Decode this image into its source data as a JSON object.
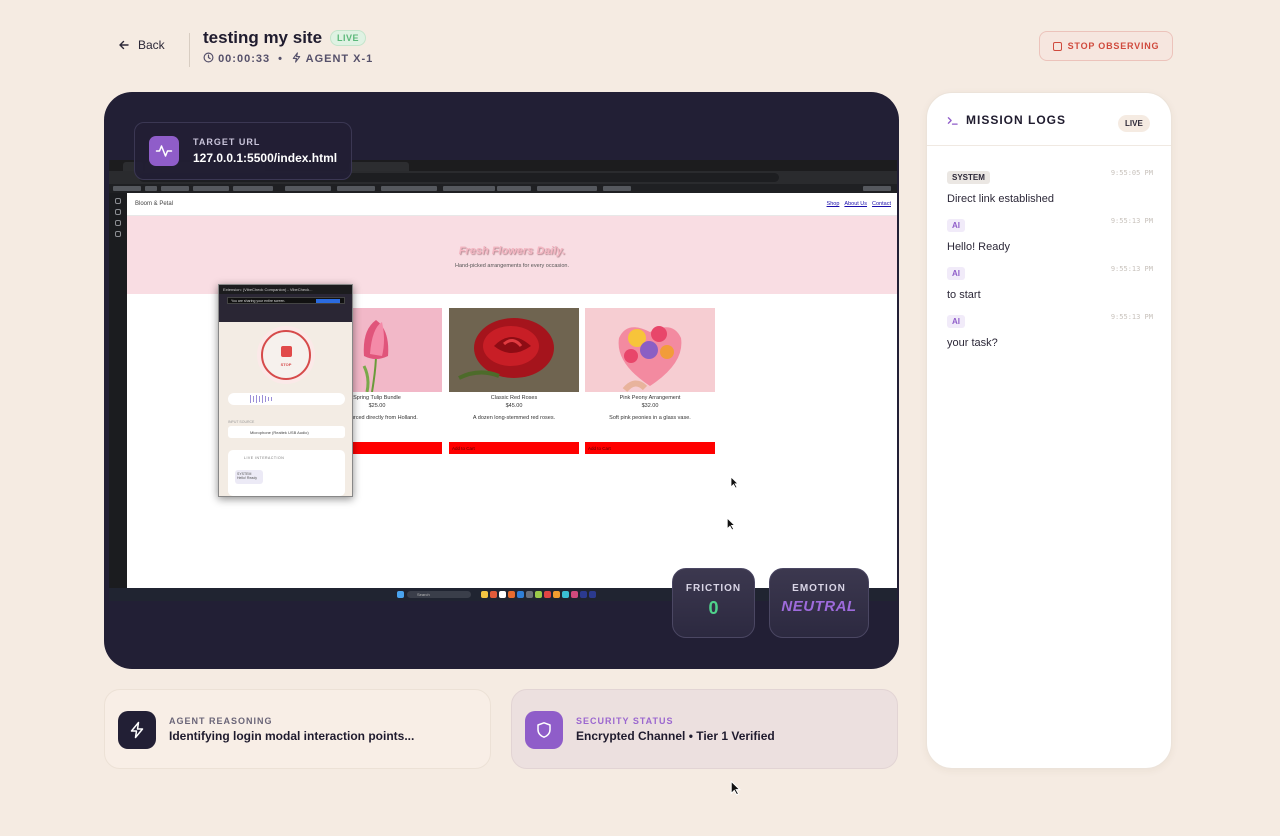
{
  "header": {
    "back_label": "Back",
    "title": "testing my site",
    "status_badge": "LIVE",
    "timer": "00:00:33",
    "separator": "•",
    "agent": "AGENT X-1",
    "stop_label": "STOP OBSERVING"
  },
  "viewer": {
    "target_label": "TARGET URL",
    "target_url": "127.0.0.1:5500/index.html",
    "site": {
      "logo": "Bloom & Petal",
      "nav": [
        "Shop",
        "About Us",
        "Contact"
      ],
      "hero_title": "Fresh Flowers Daily.",
      "hero_subtitle": "Hand-picked arrangements for every occasion.",
      "products": [
        {
          "name": "Spring Tulip Bundle",
          "price": "$25.00",
          "desc": "...s sourced directly from Holland.",
          "button": "Add to Cart"
        },
        {
          "name": "Classic Red Roses",
          "price": "$45.00",
          "desc": "A dozen long-stemmed red roses.",
          "button": "Add to Cart"
        },
        {
          "name": "Pink Peony Arrangement",
          "price": "$32.00",
          "desc": "Soft pink peonies in a glass vase.",
          "button": "Add to Cart"
        }
      ]
    },
    "extension": {
      "titlebar": "Extension: (VibeCheck Companion) - VibeCheck...",
      "share_notice": "You are sharing your entire screen.",
      "share_button": "Stop Sharing",
      "stop_label": "STOP",
      "input_label": "INPUT SOURCE",
      "input_value": "Microphone (Realtek USB Audio)",
      "interaction_title": "LIVE INTERACTION",
      "message_role": "SYSTEM",
      "message_text": "Hello! Ready"
    },
    "taskbar_search": "Search",
    "metrics": {
      "friction_label": "FRICTION",
      "friction_value": "0",
      "emotion_label": "EMOTION",
      "emotion_value": "NEUTRAL"
    }
  },
  "reasoning": {
    "label": "AGENT REASONING",
    "text": "Identifying login modal interaction points..."
  },
  "security": {
    "label": "SECURITY STATUS",
    "text": "Encrypted Channel • Tier 1 Verified"
  },
  "logs": {
    "title": "MISSION LOGS",
    "status": "LIVE",
    "entries": [
      {
        "role": "SYSTEM",
        "time": "9:55:05 PM",
        "message": "Direct link established"
      },
      {
        "role": "AI",
        "time": "9:55:13 PM",
        "message": "Hello! Ready"
      },
      {
        "role": "AI",
        "time": "9:55:13 PM",
        "message": "to start"
      },
      {
        "role": "AI",
        "time": "9:55:13 PM",
        "message": "your task?"
      }
    ]
  },
  "colors": {
    "background": "#f5ebe2",
    "viewer_bg": "#221f35",
    "accent_purple": "#8f5dc9",
    "live_green": "#5cb87a",
    "stop_red": "#d04a3d",
    "friction_green": "#4fd18b"
  },
  "icons": {
    "back": "arrow-left-icon",
    "timer": "clock-icon",
    "agent": "lightning-icon",
    "target": "activity-pulse-icon",
    "reasoning": "lightning-icon",
    "security": "shield-icon",
    "logs": "terminal-prompt-icon"
  }
}
